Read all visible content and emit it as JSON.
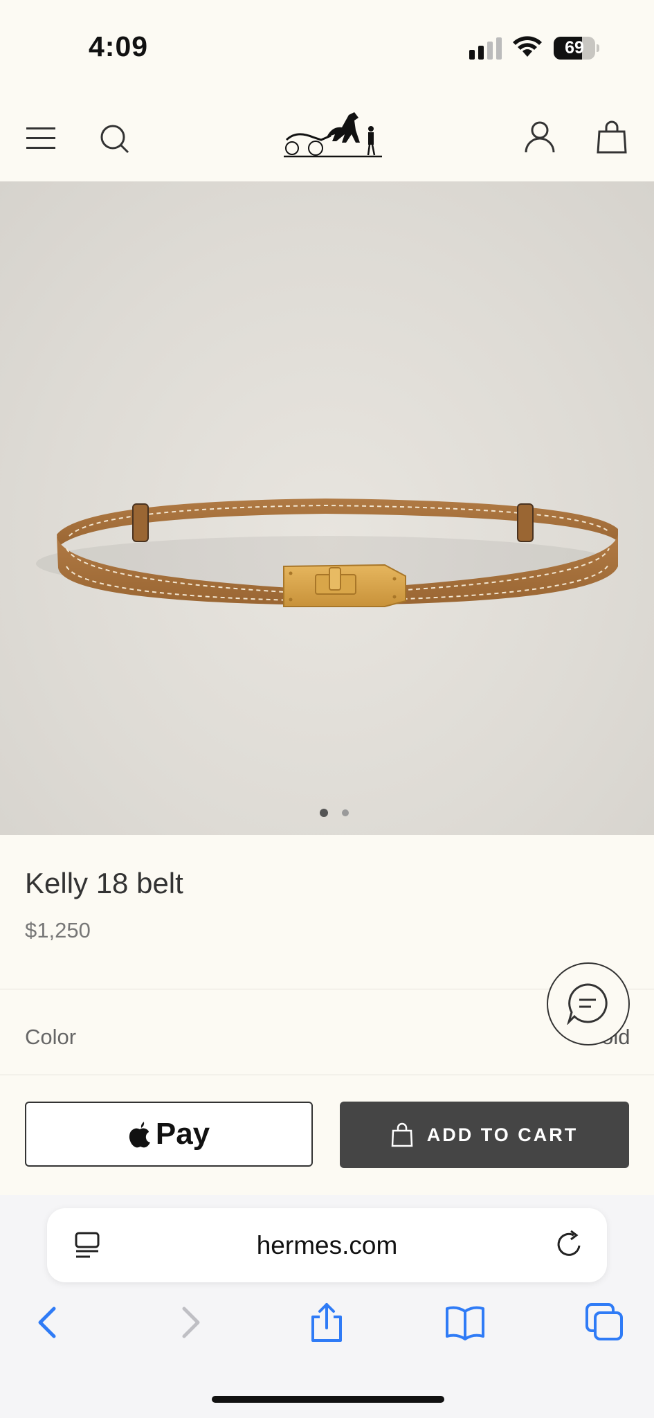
{
  "status_bar": {
    "time": "4:09",
    "battery_level": "69"
  },
  "header": {
    "brand_logo": "carriage-logo",
    "icons": [
      "menu-icon",
      "search-icon",
      "account-icon",
      "shopping-bag-icon"
    ]
  },
  "gallery": {
    "image": "Kelly 18 belt product photo",
    "dots_total": 2,
    "active_dot": 1
  },
  "product": {
    "title": "Kelly 18 belt",
    "price": "$1,250"
  },
  "options": {
    "color_label": "Color",
    "color_value": "Gold"
  },
  "actions": {
    "apple_pay_label": "Pay",
    "add_to_cart_label": "ADD TO CART"
  },
  "browser": {
    "url": "hermes.com"
  },
  "colors": {
    "background": "#fcfaf3",
    "cart_button": "#454545",
    "safari_blue": "#2f7bf6"
  }
}
